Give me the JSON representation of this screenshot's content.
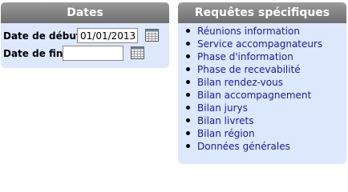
{
  "dates_panel": {
    "title": "Dates",
    "start_label": "Date de début",
    "start_value": "01/01/2013",
    "end_label": "Date de fin",
    "end_value": "",
    "calendar_icon": "calendar-icon"
  },
  "requests_panel": {
    "title": "Requêtes spécifiques",
    "links": [
      "Réunions information",
      "Service accompagnateurs",
      "Phase d'information",
      "Phase de recevabilité",
      "Bilan rendez-vous",
      "Bilan accompagnement",
      "Bilan jurys",
      "Bilan livrets",
      "Bilan région",
      "Données générales"
    ]
  },
  "colors": {
    "header_gradient_top": "#9a9a9a",
    "header_gradient_bottom": "#6f6f6f",
    "panel_background": "#dde8fd",
    "link_color": "#1a1a9e"
  }
}
